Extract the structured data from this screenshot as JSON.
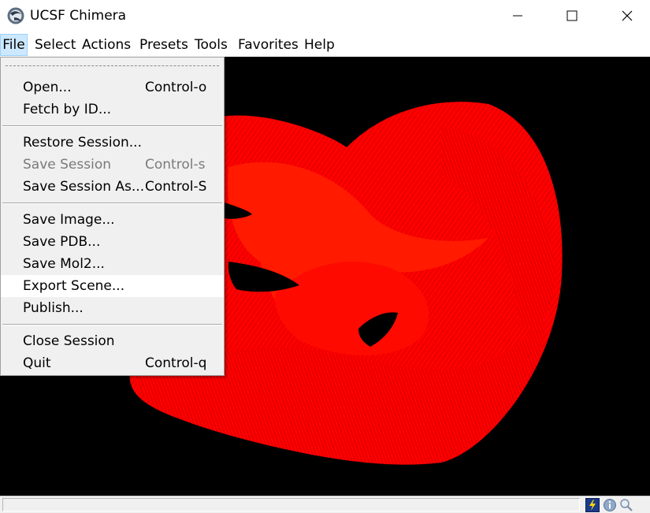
{
  "window": {
    "title": "UCSF Chimera",
    "icon": "chimera-app-icon",
    "controls": [
      "minimize",
      "maximize",
      "close"
    ]
  },
  "menubar": {
    "items": [
      "File",
      "Select",
      "Actions",
      "Presets",
      "Tools",
      "Favorites",
      "Help"
    ],
    "active": "File"
  },
  "file_menu": {
    "items": [
      {
        "label": "Open...",
        "accelerator": "Control-o"
      },
      {
        "label": "Fetch by ID...",
        "accelerator": ""
      },
      {
        "label": "Restore Session...",
        "accelerator": ""
      },
      {
        "label": "Save Session",
        "accelerator": "Control-s",
        "disabled": true
      },
      {
        "label": "Save Session As...",
        "accelerator": "Control-S"
      },
      {
        "label": "Save Image...",
        "accelerator": ""
      },
      {
        "label": "Save PDB...",
        "accelerator": ""
      },
      {
        "label": "Save Mol2...",
        "accelerator": ""
      },
      {
        "label": "Export Scene...",
        "accelerator": "",
        "highlighted": true
      },
      {
        "label": "Publish...",
        "accelerator": ""
      },
      {
        "label": "Close Session",
        "accelerator": ""
      },
      {
        "label": "Quit",
        "accelerator": "Control-q"
      }
    ]
  },
  "viewport": {
    "background": "#000000",
    "model_color": "#ff0000"
  },
  "statusbar": {
    "icons": [
      "lightning-icon",
      "info-icon",
      "magnifier-icon"
    ]
  }
}
